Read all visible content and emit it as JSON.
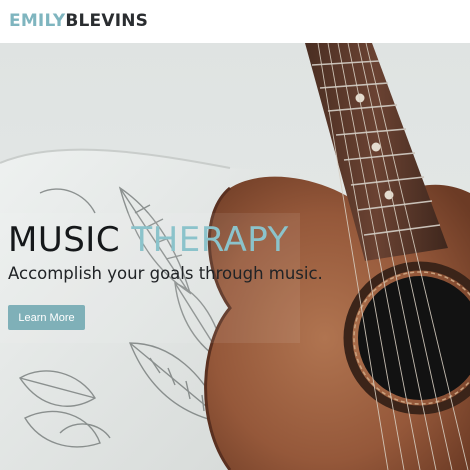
{
  "header": {
    "logo_first": "EMILY",
    "logo_last": "BLEVINS"
  },
  "hero": {
    "title_word1": "MUSIC",
    "title_word2": "THERAPY",
    "subtitle": "Accomplish your goals through music.",
    "cta_label": "Learn More",
    "background_image": "acoustic-guitar-on-leaf-pillow"
  },
  "colors": {
    "accent": "#8bc3cb",
    "button": "#7fb0b8",
    "heading_dark": "#15181a",
    "logo_dark": "#2a2d30"
  }
}
